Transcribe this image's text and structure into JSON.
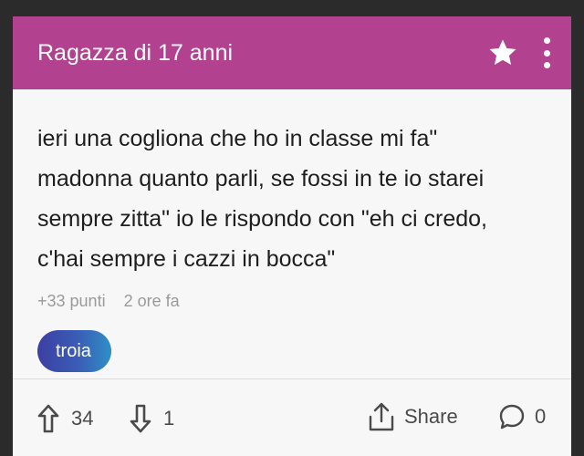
{
  "header": {
    "title": "Ragazza di 17 anni",
    "star_icon": "star-icon",
    "menu_icon": "more-vertical-icon",
    "color": "#b2418f"
  },
  "post": {
    "text": "ieri una cogliona che ho in classe mi fa\"\nmadonna quanto parli, se fossi in te io starei\nsempre zitta\" io le rispondo con \"eh ci credo,\nc'hai sempre i cazzi in bocca\"",
    "points": "+33 punti",
    "time": "2 ore fa",
    "tag": "troia"
  },
  "footer": {
    "upvotes": "34",
    "downvotes": "1",
    "share_label": "Share",
    "comments": "0"
  }
}
